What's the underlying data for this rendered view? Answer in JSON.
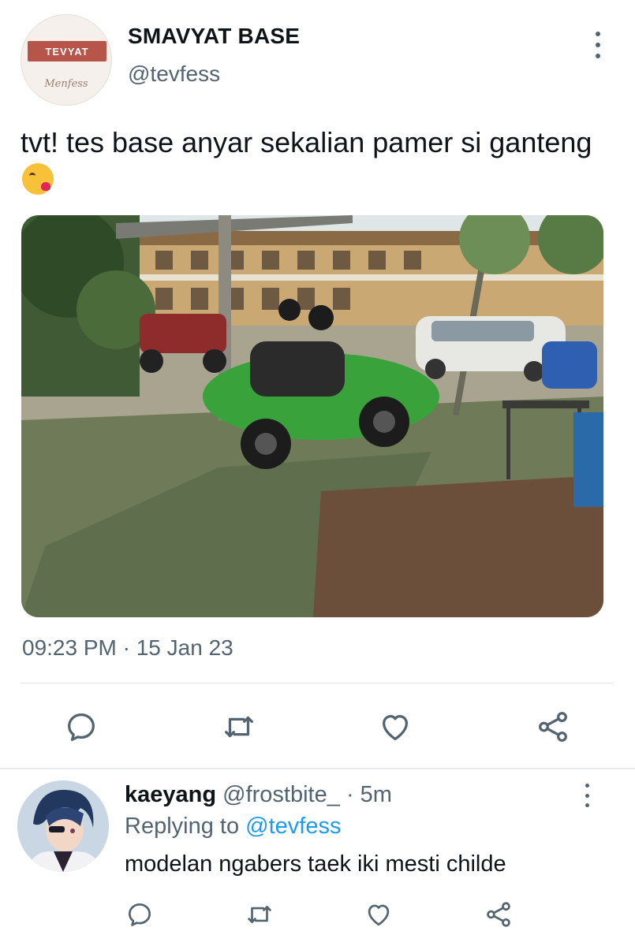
{
  "tweet": {
    "avatar": {
      "ribbon_text": "TEVYAT",
      "script_text": "Menfess",
      "ribbon_color": "#b8554a"
    },
    "display_name": "SMAVYAT BASE",
    "handle": "@tevfess",
    "text": "tvt! tes base anyar sekalian pamer si ganteng",
    "emoji": "kissing-heart-emoji",
    "media": {
      "description_icon": "photo-motorcycle-parking"
    },
    "timestamp": "09:23 PM · 15 Jan 23",
    "actions": {
      "reply_icon": "reply-icon",
      "retweet_icon": "retweet-icon",
      "like_icon": "heart-icon",
      "share_icon": "share-icon"
    }
  },
  "reply": {
    "display_name": "kaeyang",
    "handle": "@frostbite_",
    "separator": "·",
    "time": "5m",
    "replying_prefix": "Replying to ",
    "replying_mention": "@tevfess",
    "text": "modelan ngabers taek iki mesti childe"
  },
  "colors": {
    "text_primary": "#0f1419",
    "text_secondary": "#536471",
    "link": "#1d9bf0",
    "divider": "#dfe5e9"
  }
}
